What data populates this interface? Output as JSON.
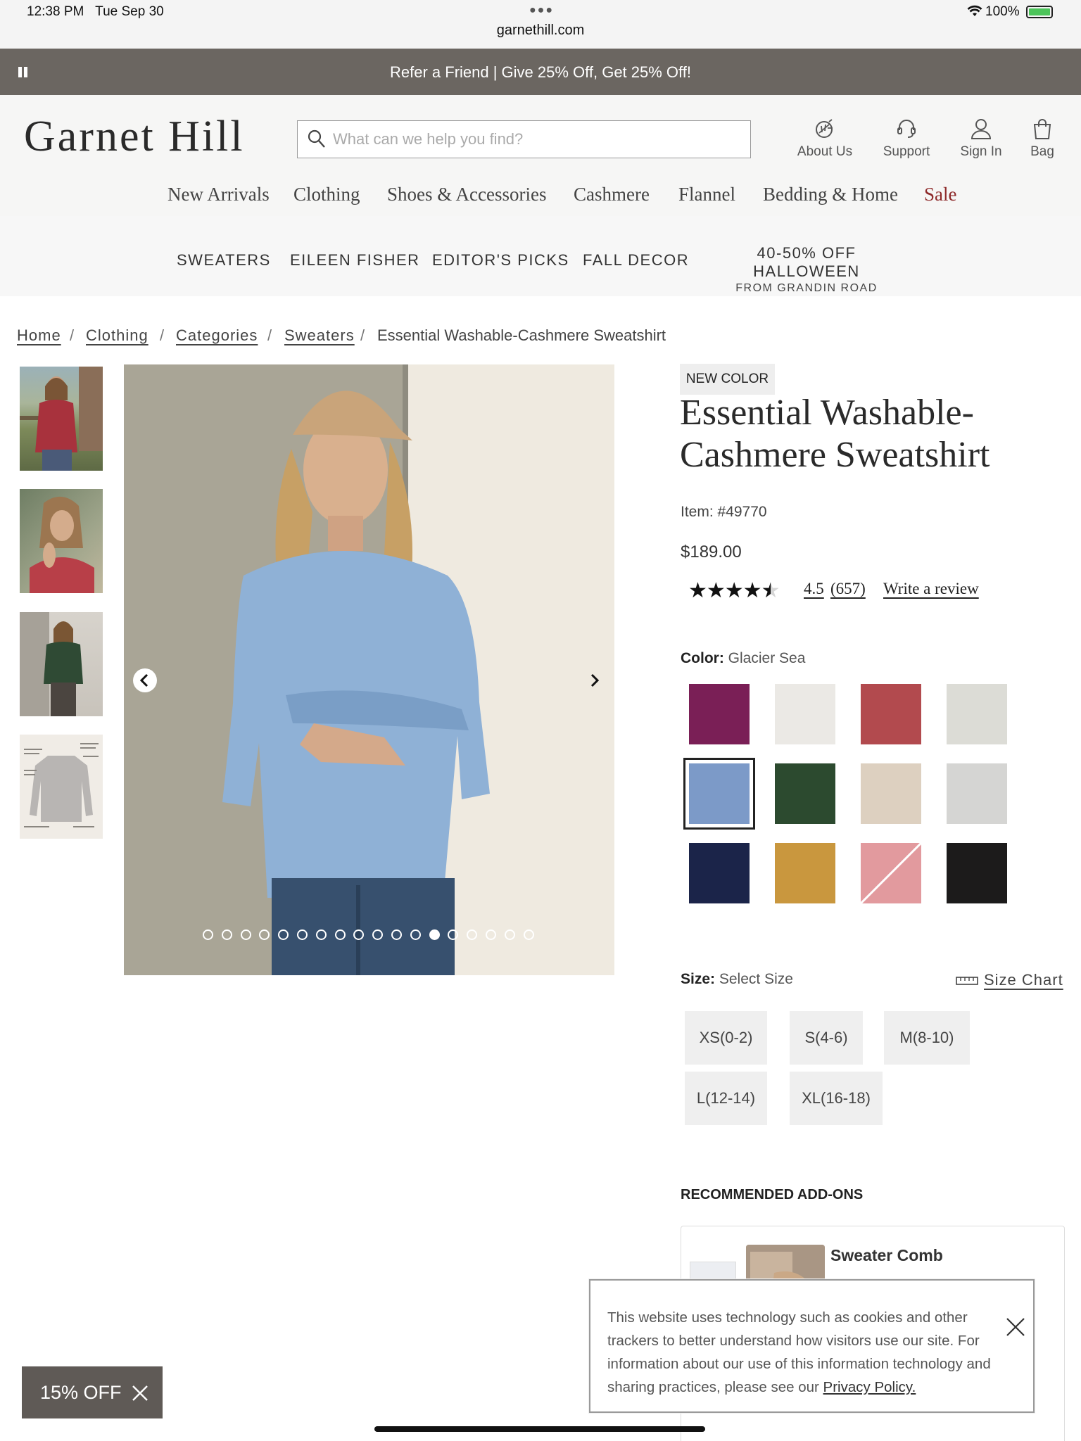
{
  "status_bar": {
    "time": "12:38 PM",
    "date": "Tue Sep 30",
    "url": "garnethill.com",
    "battery": "100%"
  },
  "promo_banner": {
    "text": "Refer a Friend | Give 25% Off, Get 25% Off!"
  },
  "header": {
    "logo": "Garnet Hill",
    "search_placeholder": "What can we help you find?",
    "icons": [
      {
        "label": "About Us",
        "icon": "leaf-icon"
      },
      {
        "label": "Support",
        "icon": "headset-icon"
      },
      {
        "label": "Sign In",
        "icon": "user-icon"
      },
      {
        "label": "Bag",
        "icon": "bag-icon"
      }
    ]
  },
  "main_nav": [
    "New Arrivals",
    "Clothing",
    "Shoes & Accessories",
    "Cashmere",
    "Flannel",
    "Bedding & Home",
    "Sale"
  ],
  "sub_nav": {
    "items": [
      "SWEATERS",
      "EILEEN FISHER",
      "EDITOR'S PICKS",
      "FALL DECOR"
    ],
    "promo_line1": "40-50% OFF HALLOWEEN",
    "promo_line2": "FROM GRANDIN ROAD"
  },
  "breadcrumb": [
    "Home",
    "Clothing",
    "Categories",
    "Sweaters",
    "Essential Washable-Cashmere Sweatshirt"
  ],
  "gallery": {
    "dot_count": 18,
    "active_dot": 12
  },
  "product": {
    "badge": "NEW COLOR",
    "title_line1": "Essential Washable-",
    "title_line2": "Cashmere Sweatshirt",
    "item_number": "Item: #49770",
    "price": "$189.00",
    "stars": "★★★★★",
    "rating": 4.5,
    "rating_label": "4.5",
    "review_count": "(657)",
    "write_review": "Write a review",
    "color_label": "Color:",
    "color_value": "Glacier Sea",
    "swatches": [
      {
        "color": "#7a1f56"
      },
      {
        "color": "#ebe9e5"
      },
      {
        "color": "#b24a4e"
      },
      {
        "color": "#dcdcd6"
      },
      {
        "color": "#7c9ac8",
        "selected": true
      },
      {
        "color": "#2c4a2f"
      },
      {
        "color": "#ddd0c0"
      },
      {
        "color": "#d5d5d3"
      },
      {
        "color": "#1b2449"
      },
      {
        "color": "#c9973e"
      },
      {
        "color": "#e29a9e",
        "sold_out": true
      },
      {
        "color": "#1c1b1b"
      }
    ],
    "size_label": "Size:",
    "size_value": "Select Size",
    "size_chart": "Size Chart",
    "sizes": [
      "XS(0-2)",
      "S(4-6)",
      "M(8-10)",
      "L(12-14)",
      "XL(16-18)"
    ]
  },
  "addons": {
    "title": "RECOMMENDED ADD-ONS",
    "item_name": "Sweater Comb"
  },
  "cookie_banner": {
    "text": "This website uses technology such as cookies and other trackers to better understand how visitors use our site. For information about our use of this information technology and sharing practices, please see our",
    "link": "Privacy Policy."
  },
  "discount_tab": {
    "text": "15% OFF"
  }
}
